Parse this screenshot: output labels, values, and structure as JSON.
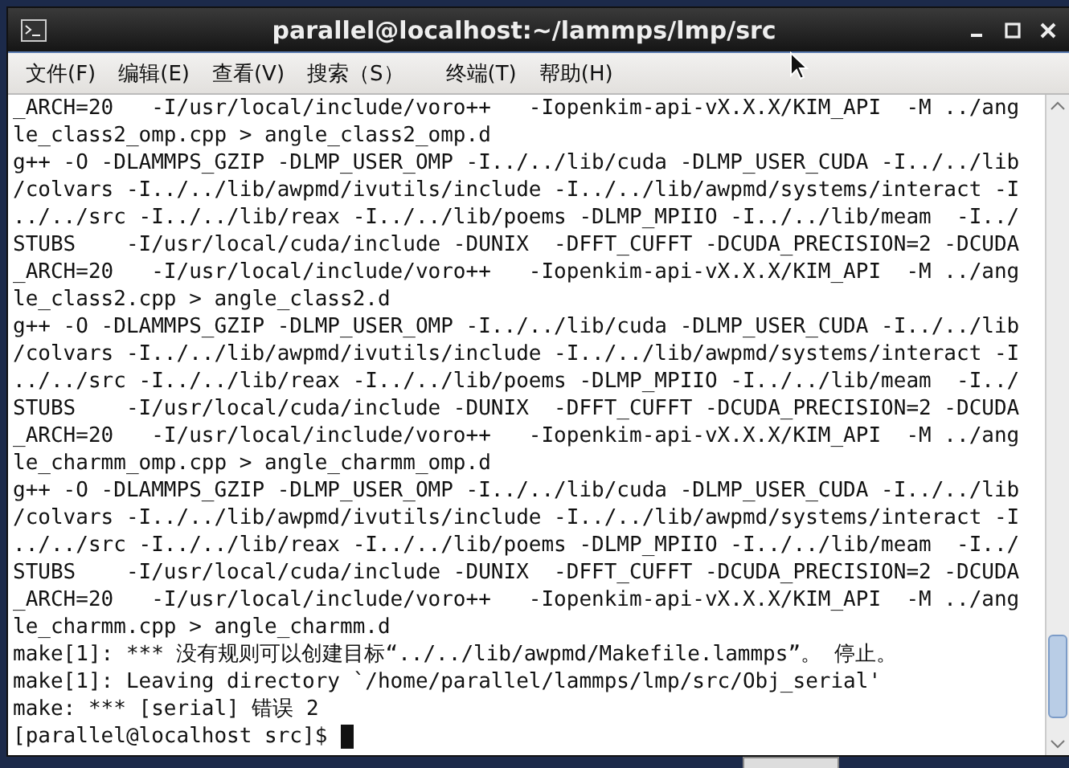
{
  "window": {
    "title": "parallel@localhost:~/lammps/lmp/src"
  },
  "menu": [
    "文件(F)",
    "编辑(E)",
    "查看(V)",
    "搜索（S）",
    "终端(T)",
    "帮助(H)"
  ],
  "terminal": {
    "lines": [
      "_ARCH=20   -I/usr/local/include/voro++   -Iopenkim-api-vX.X.X/KIM_API  -M ../ang",
      "le_class2_omp.cpp > angle_class2_omp.d",
      "g++ -O -DLAMMPS_GZIP -DLMP_USER_OMP -I../../lib/cuda -DLMP_USER_CUDA -I../../lib",
      "/colvars -I../../lib/awpmd/ivutils/include -I../../lib/awpmd/systems/interact -I",
      "../../src -I../../lib/reax -I../../lib/poems -DLMP_MPIIO -I../../lib/meam  -I../",
      "STUBS    -I/usr/local/cuda/include -DUNIX  -DFFT_CUFFT -DCUDA_PRECISION=2 -DCUDA",
      "_ARCH=20   -I/usr/local/include/voro++   -Iopenkim-api-vX.X.X/KIM_API  -M ../ang",
      "le_class2.cpp > angle_class2.d",
      "g++ -O -DLAMMPS_GZIP -DLMP_USER_OMP -I../../lib/cuda -DLMP_USER_CUDA -I../../lib",
      "/colvars -I../../lib/awpmd/ivutils/include -I../../lib/awpmd/systems/interact -I",
      "../../src -I../../lib/reax -I../../lib/poems -DLMP_MPIIO -I../../lib/meam  -I../",
      "STUBS    -I/usr/local/cuda/include -DUNIX  -DFFT_CUFFT -DCUDA_PRECISION=2 -DCUDA",
      "_ARCH=20   -I/usr/local/include/voro++   -Iopenkim-api-vX.X.X/KIM_API  -M ../ang",
      "le_charmm_omp.cpp > angle_charmm_omp.d",
      "g++ -O -DLAMMPS_GZIP -DLMP_USER_OMP -I../../lib/cuda -DLMP_USER_CUDA -I../../lib",
      "/colvars -I../../lib/awpmd/ivutils/include -I../../lib/awpmd/systems/interact -I",
      "../../src -I../../lib/reax -I../../lib/poems -DLMP_MPIIO -I../../lib/meam  -I../",
      "STUBS    -I/usr/local/cuda/include -DUNIX  -DFFT_CUFFT -DCUDA_PRECISION=2 -DCUDA",
      "_ARCH=20   -I/usr/local/include/voro++   -Iopenkim-api-vX.X.X/KIM_API  -M ../ang",
      "le_charmm.cpp > angle_charmm.d",
      "make[1]: *** 没有规则可以创建目标“../../lib/awpmd/Makefile.lammps”。 停止。",
      "make[1]: Leaving directory `/home/parallel/lammps/lmp/src/Obj_serial'",
      "make: *** [serial] 错误 2"
    ],
    "prompt": "[parallel@localhost src]$ "
  }
}
